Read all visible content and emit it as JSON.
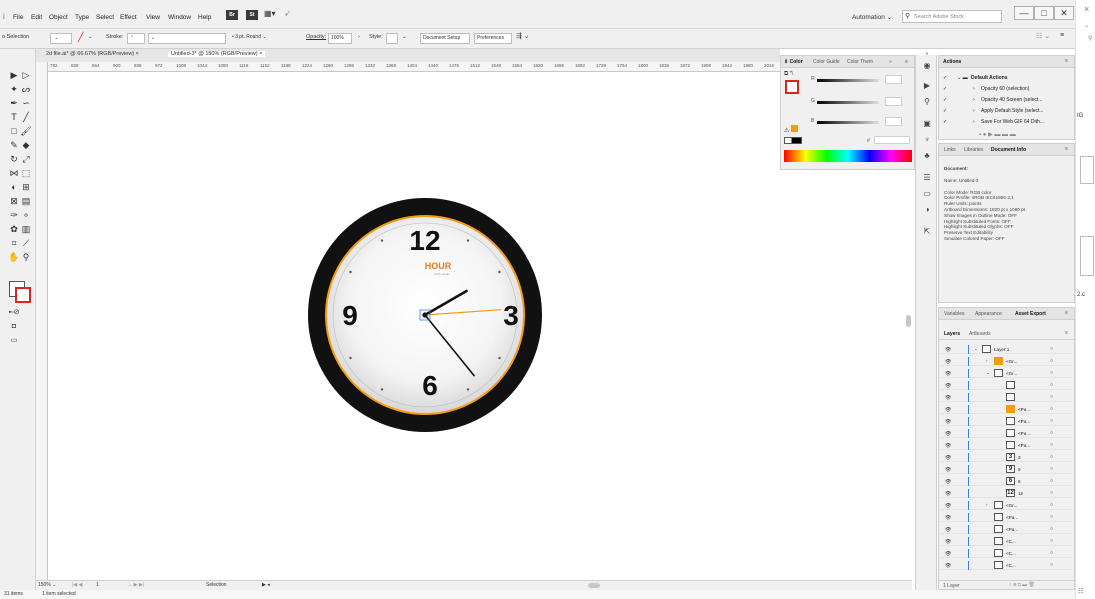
{
  "menu": {
    "items": [
      "File",
      "Edit",
      "Object",
      "Type",
      "Select",
      "Effect",
      "View",
      "Window",
      "Help"
    ],
    "bridge_labels": [
      "Br",
      "St"
    ],
    "workspace": "Automation",
    "search_placeholder": "Search Adobe Stock",
    "window_controls": [
      "—",
      "□",
      "✕"
    ],
    "outer_close": "×"
  },
  "control": {
    "selection_label": "o Selection",
    "stroke_label": "Stroke:",
    "brush": "3 pt. Round",
    "opacity_label": "Opacity:",
    "opacity_value": "100%",
    "style_label": "Style:",
    "document_setup": "Document Setup",
    "preferences": "Preferences"
  },
  "tabs": [
    {
      "label": "2d file.ai* @ 66.67% (RGB/Preview)",
      "close": "×"
    },
    {
      "label": "Untitled-3* @ 150% (RGB/Preview)",
      "close": "×"
    }
  ],
  "ruler_labels": [
    "792",
    "828",
    "864",
    "900",
    "936",
    "972",
    "1008",
    "1044",
    "1080",
    "1116",
    "1152",
    "1188",
    "1224",
    "1260",
    "1296",
    "1332",
    "1368",
    "1404",
    "1440",
    "1476",
    "1512",
    "1548",
    "1584",
    "1620",
    "1656",
    "1692",
    "1728",
    "1764",
    "1800",
    "1836",
    "1872",
    "1908",
    "1944",
    "1980",
    "2016"
  ],
  "clock": {
    "numbers": [
      "12",
      "3",
      "6",
      "9"
    ],
    "brand": "HOUR",
    "brand_sub": "clock studio",
    "rim_color": "#111111",
    "accent_color": "#f39c12",
    "hands": {
      "hour_angle_deg": 60,
      "minute_angle_deg": 141,
      "second_angle_deg": 86
    }
  },
  "color_panel": {
    "tabs": [
      "Color",
      "Color Guide",
      "Color Them"
    ],
    "channels": [
      "R",
      "G",
      "B"
    ],
    "hex_label": "#"
  },
  "actions_panel": {
    "title": "Actions",
    "rows": [
      {
        "label": "Default Actions",
        "checked": true
      },
      {
        "label": "Opacity 60 (selection)",
        "checked": true
      },
      {
        "label": "Opacity 40 Screen (select...",
        "checked": true
      },
      {
        "label": "Apply Default Style (select...",
        "checked": true
      },
      {
        "label": "Save For Web GIF 64 Dith...",
        "checked": true
      }
    ]
  },
  "doc_info_panel": {
    "tabs": [
      "Links",
      "Libraries",
      "Document Info"
    ],
    "heading": "Document:",
    "lines": [
      "Name: Untitled-3",
      "",
      "Color Mode: RGB color",
      "Color Profile: sRGB IEC61966-2.1",
      "Ruler Units: points",
      "Artboard Dimensions: 1920 pt x 1080 pt",
      "Show Images in Outline Mode: OFF",
      "Highlight Substituted Fonts: OFF",
      "Highlight Substituted Glyphs: OFF",
      "Preserve Text Editability",
      "Simulate Colored Paper: OFF"
    ]
  },
  "layers_panel": {
    "top_tabs": [
      "Variables",
      "Appearance",
      "Asset Export"
    ],
    "tabs": [
      "Layers",
      "Artboards"
    ],
    "rows": [
      {
        "name": "Layer 1",
        "thumb": "",
        "indent": 0,
        "arrow": "v"
      },
      {
        "name": "<Gr...",
        "thumb": "",
        "indent": 1,
        "arrow": ">"
      },
      {
        "name": "<Gr...",
        "thumb": "",
        "indent": 1,
        "arrow": "v"
      },
      {
        "name": "",
        "thumb": "",
        "indent": 2,
        "arrow": ""
      },
      {
        "name": "",
        "thumb": "",
        "indent": 2,
        "arrow": ""
      },
      {
        "name": "<Pa...",
        "thumb": "",
        "indent": 2,
        "arrow": ""
      },
      {
        "name": "<Pa...",
        "thumb": "",
        "indent": 2,
        "arrow": ""
      },
      {
        "name": "<Pa...",
        "thumb": "",
        "indent": 2,
        "arrow": ""
      },
      {
        "name": "<Pa...",
        "thumb": "",
        "indent": 2,
        "arrow": ""
      },
      {
        "name": "3",
        "thumb": "3",
        "indent": 2,
        "arrow": ""
      },
      {
        "name": "9",
        "thumb": "9",
        "indent": 2,
        "arrow": ""
      },
      {
        "name": "6",
        "thumb": "6",
        "indent": 2,
        "arrow": ""
      },
      {
        "name": "12",
        "thumb": "12",
        "indent": 2,
        "arrow": ""
      },
      {
        "name": "<Gr...",
        "thumb": "",
        "indent": 1,
        "arrow": ">"
      },
      {
        "name": "<Pa...",
        "thumb": "",
        "indent": 1,
        "arrow": ""
      },
      {
        "name": "<Pa...",
        "thumb": "",
        "indent": 1,
        "arrow": ""
      },
      {
        "name": "<C...",
        "thumb": "",
        "indent": 1,
        "arrow": ""
      },
      {
        "name": "<C...",
        "thumb": "",
        "indent": 1,
        "arrow": ""
      },
      {
        "name": "<C...",
        "thumb": "",
        "indent": 1,
        "arrow": ""
      }
    ],
    "footer": "1 Layer"
  },
  "status": {
    "zoom": "150%",
    "page": "1",
    "tool": "Selection"
  },
  "explorer": {
    "items": "31 items",
    "selected": "1 item selected",
    "side_labels": [
      "IG",
      "2.c"
    ]
  }
}
